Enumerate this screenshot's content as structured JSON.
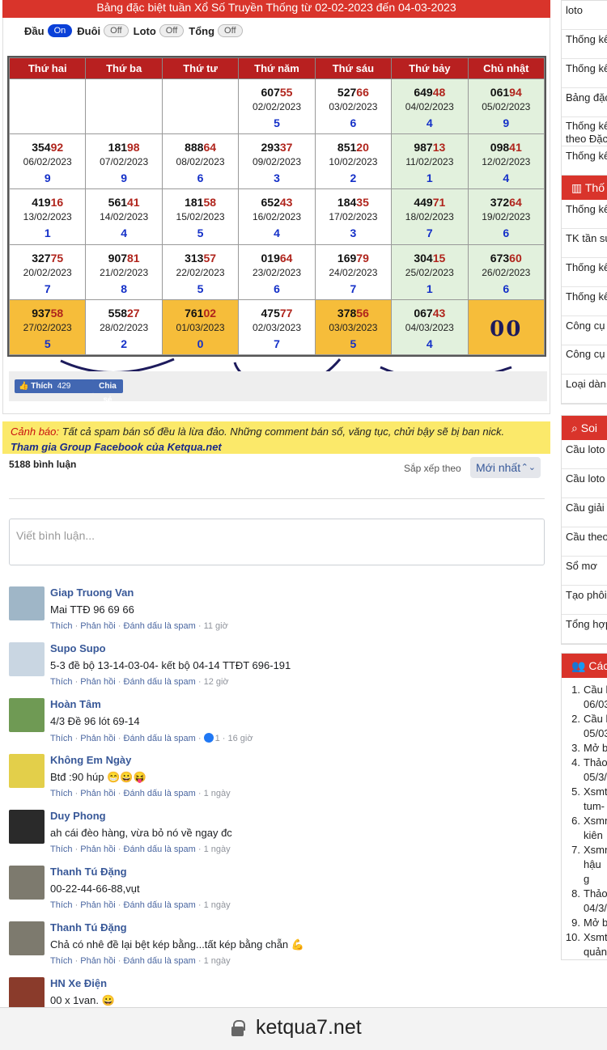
{
  "title": "Bảng đặc biệt tuần Xổ Số Truyền Thống từ 02-02-2023 đến 04-03-2023",
  "toggles": [
    {
      "label": "Đầu",
      "state": "On"
    },
    {
      "label": "Đuôi",
      "state": "Off"
    },
    {
      "label": "Loto",
      "state": "Off"
    },
    {
      "label": "Tổng",
      "state": "Off"
    }
  ],
  "weekdays": [
    "Thứ hai",
    "Thứ ba",
    "Thứ tư",
    "Thứ năm",
    "Thứ sáu",
    "Thứ bảy",
    "Chủ nhật"
  ],
  "weeks": [
    [
      null,
      null,
      null,
      {
        "head": "607",
        "tail": "55",
        "date": "02/02/2023",
        "sum": "5"
      },
      {
        "head": "527",
        "tail": "66",
        "date": "03/02/2023",
        "sum": "6"
      },
      {
        "head": "649",
        "tail": "48",
        "date": "04/02/2023",
        "sum": "4"
      },
      {
        "head": "061",
        "tail": "94",
        "date": "05/02/2023",
        "sum": "9"
      }
    ],
    [
      {
        "head": "354",
        "tail": "92",
        "date": "06/02/2023",
        "sum": "9"
      },
      {
        "head": "181",
        "tail": "98",
        "date": "07/02/2023",
        "sum": "9"
      },
      {
        "head": "888",
        "tail": "64",
        "date": "08/02/2023",
        "sum": "6"
      },
      {
        "head": "293",
        "tail": "37",
        "date": "09/02/2023",
        "sum": "3"
      },
      {
        "head": "851",
        "tail": "20",
        "date": "10/02/2023",
        "sum": "2"
      },
      {
        "head": "987",
        "tail": "13",
        "date": "11/02/2023",
        "sum": "1"
      },
      {
        "head": "098",
        "tail": "41",
        "date": "12/02/2023",
        "sum": "4"
      }
    ],
    [
      {
        "head": "419",
        "tail": "16",
        "date": "13/02/2023",
        "sum": "1"
      },
      {
        "head": "561",
        "tail": "41",
        "date": "14/02/2023",
        "sum": "4"
      },
      {
        "head": "181",
        "tail": "58",
        "date": "15/02/2023",
        "sum": "5"
      },
      {
        "head": "652",
        "tail": "43",
        "date": "16/02/2023",
        "sum": "4"
      },
      {
        "head": "184",
        "tail": "35",
        "date": "17/02/2023",
        "sum": "3"
      },
      {
        "head": "449",
        "tail": "71",
        "date": "18/02/2023",
        "sum": "7"
      },
      {
        "head": "372",
        "tail": "64",
        "date": "19/02/2023",
        "sum": "6"
      }
    ],
    [
      {
        "head": "327",
        "tail": "75",
        "date": "20/02/2023",
        "sum": "7"
      },
      {
        "head": "907",
        "tail": "81",
        "date": "21/02/2023",
        "sum": "8"
      },
      {
        "head": "313",
        "tail": "57",
        "date": "22/02/2023",
        "sum": "5"
      },
      {
        "head": "019",
        "tail": "64",
        "date": "23/02/2023",
        "sum": "6"
      },
      {
        "head": "169",
        "tail": "79",
        "date": "24/02/2023",
        "sum": "7"
      },
      {
        "head": "304",
        "tail": "15",
        "date": "25/02/2023",
        "sum": "1"
      },
      {
        "head": "673",
        "tail": "60",
        "date": "26/02/2023",
        "sum": "6"
      }
    ],
    [
      {
        "head": "937",
        "tail": "58",
        "date": "27/02/2023",
        "sum": "5",
        "hl": true
      },
      {
        "head": "558",
        "tail": "27",
        "date": "28/02/2023",
        "sum": "2"
      },
      {
        "head": "761",
        "tail": "02",
        "date": "01/03/2023",
        "sum": "0",
        "hl": true
      },
      {
        "head": "475",
        "tail": "77",
        "date": "02/03/2023",
        "sum": "7"
      },
      {
        "head": "378",
        "tail": "56",
        "date": "03/03/2023",
        "sum": "5",
        "hl": true
      },
      {
        "head": "067",
        "tail": "43",
        "date": "04/03/2023",
        "sum": "4"
      },
      {
        "handwritten": "00",
        "hl": true
      }
    ]
  ],
  "share": {
    "like_label": "Thích",
    "like_count": "429",
    "share_label": "Chia sẻ"
  },
  "warning": {
    "prefix": "Cảnh báo:",
    "text": " Tất cả spam bán số đều là lừa đảo. Những comment bán số, văng tục, chửi bậy sẽ bị ban nick.",
    "group_link": "Tham gia Group Facebook của Ketqua.net"
  },
  "comments_header": {
    "count": "5188 bình luận",
    "sort_label": "Sắp xếp theo",
    "sort_value": "Mới nhất"
  },
  "comment_input": {
    "placeholder": "Viết bình luận..."
  },
  "comment_actions": {
    "like": "Thích",
    "reply": "Phản hồi",
    "spam": "Đánh dấu là spam"
  },
  "comments": [
    {
      "name": "Giap Truong Van",
      "text": "Mai TTĐ 96 69 66",
      "time": "11 giờ",
      "avatar_color": "#9fb6c7"
    },
    {
      "name": "Supo Supo",
      "text": "5-3 đề bộ 13-14-03-04- kết bộ 04-14 TTĐT 696-191",
      "time": "12 giờ",
      "avatar_color": "#c9d6e2"
    },
    {
      "name": "Hoàn Tâm",
      "text": "4/3 Đề 96 lót 69-14",
      "time": "16 giờ",
      "reactions": "1",
      "avatar_color": "#6f9a54"
    },
    {
      "name": "Không Em Ngày",
      "text": "Btđ :90 húp 😁😀😝",
      "time": "1 ngày",
      "avatar_color": "#e3cf4a"
    },
    {
      "name": "Duy Phong",
      "text": "ah cái đèo hàng, vừa bỏ nó về ngay đc",
      "time": "1 ngày",
      "avatar_color": "#2a2a2a"
    },
    {
      "name": "Thanh Tú Đặng",
      "text": "00-22-44-66-88,vụt",
      "time": "1 ngày",
      "avatar_color": "#7d7a6e"
    },
    {
      "name": "Thanh Tú Đặng",
      "text": "Chả có nhê đề lại bệt kép bằng...tất kép bằng chẵn 💪",
      "time": "1 ngày",
      "avatar_color": "#7d7a6e"
    },
    {
      "name": "HN Xe Điện",
      "text": "00 x 1van. 😀",
      "time": "",
      "avatar_color": "#8a3b2b"
    }
  ],
  "sidebar": {
    "box1": [
      "loto",
      "Thống kê",
      "Thống kê",
      "Bảng đặc",
      "Thống kê theo Đặc",
      "Thống kê"
    ],
    "head2": "Thố",
    "box2": [
      "Thống kê",
      "TK tần su",
      "Thống kê",
      "Thống kê",
      "Công cụ",
      "Công cụ VIP",
      "Loại dàn"
    ],
    "head3": "Soi",
    "box3": [
      "Cầu loto",
      "Cầu loto",
      "Cầu giải",
      "Cầu theo",
      "Sổ mơ",
      "Tạo phôi",
      "Tổng hợp"
    ],
    "head4": "Các",
    "list4": [
      {
        "n": "1.",
        "t": "Cầu l\n06/03"
      },
      {
        "n": "2.",
        "t": "Cầu l\n05/03"
      },
      {
        "n": "3.",
        "t": "Mở b"
      },
      {
        "n": "4.",
        "t": "Thảo\n05/3/"
      },
      {
        "n": "5.",
        "t": "Xsmt\ntum-"
      },
      {
        "n": "6.",
        "t": "Xsmn\nkiên"
      },
      {
        "n": "7.",
        "t": "Xsmn\nhậu g"
      },
      {
        "n": "8.",
        "t": "Thảo\n04/3/"
      },
      {
        "n": "9.",
        "t": "Mở b"
      },
      {
        "n": "10.",
        "t": "Xsmt\nquản"
      }
    ]
  },
  "browser": {
    "url": "ketqua7.net"
  },
  "colors": {
    "header_red": "#d9342b",
    "table_header": "#b82020",
    "tail_red": "#b0241c",
    "sum_blue": "#1430c8",
    "highlight": "#f6bd3a",
    "weekend": "#e2f1dd"
  }
}
